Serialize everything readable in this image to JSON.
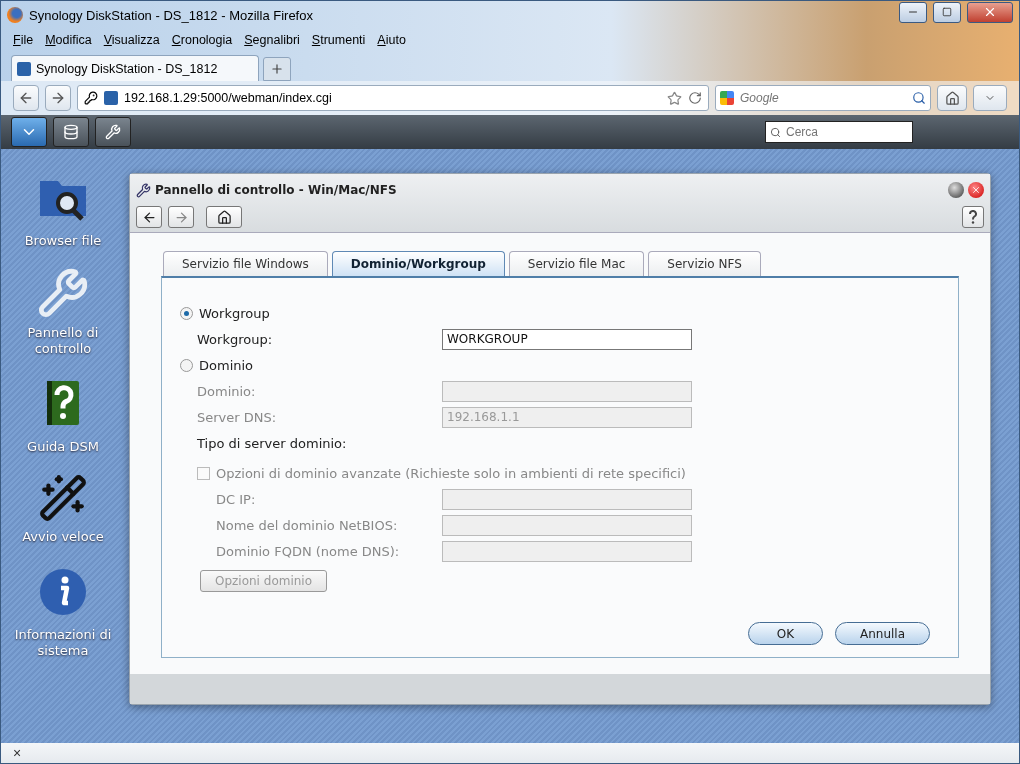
{
  "browser": {
    "title": "Synology DiskStation - DS_1812 - Mozilla Firefox",
    "menu": [
      "File",
      "Modifica",
      "Visualizza",
      "Cronologia",
      "Segnalibri",
      "Strumenti",
      "Aiuto"
    ],
    "tabs": [
      {
        "label": "Synology DiskStation - DS_1812",
        "selected": true
      }
    ],
    "url": "192.168.1.29:5000/webman/index.cgi",
    "search_placeholder": "Google"
  },
  "dsm_toolbar": {
    "search_placeholder": "Cerca"
  },
  "desktop_icons": [
    {
      "kind": "folder",
      "label": "Browser file"
    },
    {
      "kind": "tools",
      "label": "Pannello di controllo"
    },
    {
      "kind": "help",
      "label": "Guida DSM"
    },
    {
      "kind": "wand",
      "label": "Avvio veloce"
    },
    {
      "kind": "info",
      "label": "Informazioni di sistema"
    }
  ],
  "dialog": {
    "title": "Pannello di controllo - Win/Mac/NFS",
    "tabs": [
      {
        "label": "Servizio file Windows",
        "selected": false
      },
      {
        "label": "Dominio/Workgroup",
        "selected": true
      },
      {
        "label": "Servizio file Mac",
        "selected": false
      },
      {
        "label": "Servizio NFS",
        "selected": false
      }
    ],
    "modes": [
      {
        "label": "Workgroup",
        "selected": true,
        "fields": [
          {
            "kind": "input",
            "label": "Workgroup:",
            "value": "WORKGROUP",
            "disabled": false
          }
        ]
      },
      {
        "label": "Dominio",
        "selected": false,
        "fields": [
          {
            "kind": "input",
            "label": "Dominio:",
            "disabled": true
          },
          {
            "kind": "input",
            "label": "Server DNS:",
            "value": "192.168.1.1",
            "disabled": true
          },
          {
            "kind": "label",
            "label": "Tipo di server dominio:"
          }
        ]
      }
    ],
    "advanced": {
      "label": "Opzioni di dominio avanzate (Richieste solo in ambienti di rete specifici)",
      "checked": false,
      "disabled": true,
      "fields": [
        {
          "kind": "input",
          "label": "DC IP:",
          "disabled": true
        },
        {
          "kind": "input",
          "label": "Nome del dominio NetBIOS:",
          "disabled": true
        },
        {
          "kind": "input",
          "label": "Dominio FQDN (nome DNS):",
          "disabled": true
        }
      ]
    },
    "options_button": {
      "label": "Opzioni dominio",
      "disabled": true
    },
    "buttons": [
      "OK",
      "Annulla"
    ]
  },
  "status_bar": {
    "close": "×"
  }
}
